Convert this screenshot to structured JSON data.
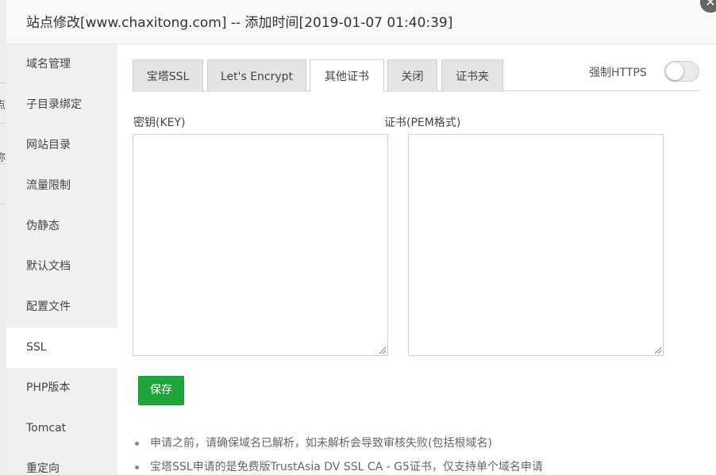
{
  "backdrop": {
    "chars": [
      "点",
      "称"
    ]
  },
  "dialog": {
    "title": "站点修改[www.chaxitong.com] -- 添加时间[2019-01-07 01:40:39]",
    "close_icon": "close-icon"
  },
  "sidebar": {
    "items": [
      {
        "label": "域名管理"
      },
      {
        "label": "子目录绑定"
      },
      {
        "label": "网站目录"
      },
      {
        "label": "流量限制"
      },
      {
        "label": "伪静态"
      },
      {
        "label": "默认文档"
      },
      {
        "label": "配置文件"
      },
      {
        "label": "SSL",
        "active": true
      },
      {
        "label": "PHP版本"
      },
      {
        "label": "Tomcat"
      },
      {
        "label": "重定向"
      }
    ]
  },
  "tabs": [
    {
      "label": "宝塔SSL"
    },
    {
      "label": "Let's Encrypt"
    },
    {
      "label": "其他证书",
      "active": true
    },
    {
      "label": "关闭"
    },
    {
      "label": "证书夹"
    }
  ],
  "force_https": {
    "label": "强制HTTPS",
    "enabled": false
  },
  "key_field": {
    "label": "密钥(KEY)",
    "value": ""
  },
  "cert_field": {
    "label": "证书(PEM格式)",
    "value": ""
  },
  "save_label": "保存",
  "notes": [
    "申请之前，请确保域名已解析，如未解析会导致审核失败(包括根域名)",
    "宝塔SSL申请的是免费版TrustAsia DV SSL CA - G5证书，仅支持单个域名申请"
  ],
  "colors": {
    "accent": "#20a53a",
    "sidebar_bg": "#f0f0f0",
    "header_bg": "#f8f8f8"
  }
}
